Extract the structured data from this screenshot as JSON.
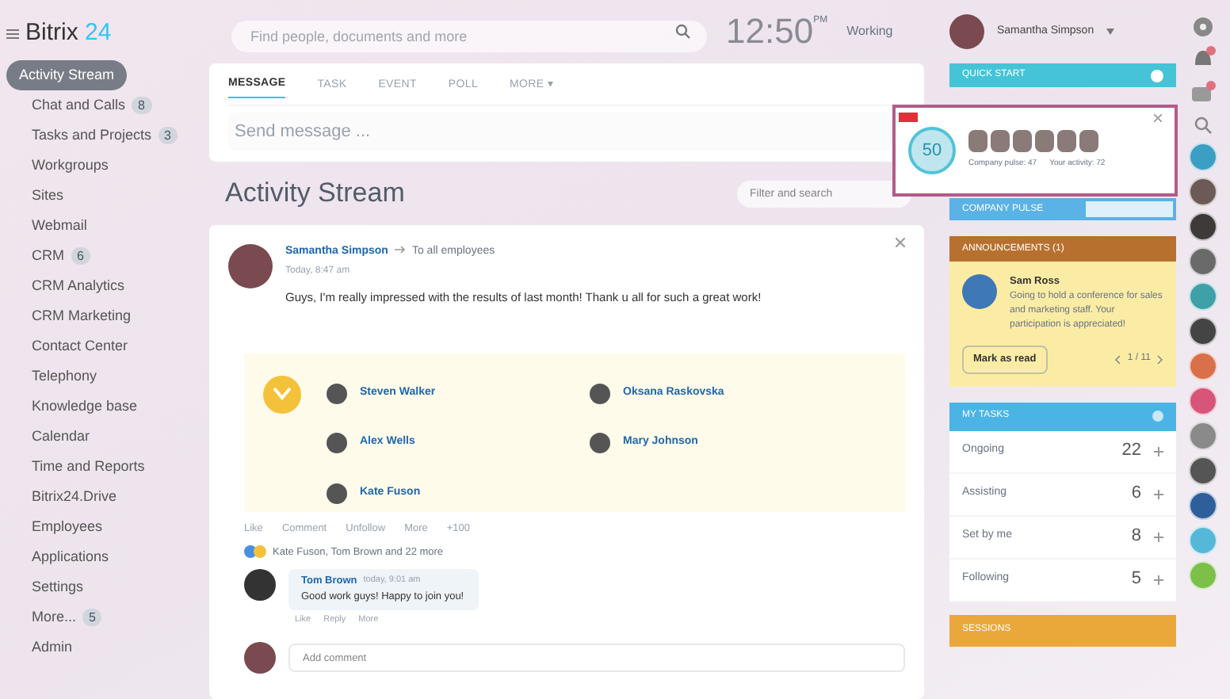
{
  "logo": {
    "name": "Bitrix",
    "suffix": "24"
  },
  "sidebar": {
    "items": [
      {
        "label": "Activity Stream",
        "selected": true
      },
      {
        "label": "Chat and Calls",
        "counter": "8",
        "selected": false
      },
      {
        "label": "Tasks and Projects",
        "counter": "3",
        "selected": false
      },
      {
        "label": "Workgroups",
        "selected": false
      },
      {
        "label": "Sites",
        "selected": false
      },
      {
        "label": "Webmail",
        "selected": false
      },
      {
        "label": "CRM",
        "counter": "6",
        "selected": false
      },
      {
        "label": "CRM Analytics",
        "selected": false
      },
      {
        "label": "CRM Marketing",
        "selected": false
      },
      {
        "label": "Contact Center",
        "selected": false
      },
      {
        "label": "Telephony",
        "selected": false
      },
      {
        "label": "Knowledge base",
        "selected": false
      },
      {
        "label": "Calendar",
        "selected": false
      },
      {
        "label": "Time and Reports",
        "selected": false
      },
      {
        "label": "Bitrix24.Drive",
        "selected": false
      },
      {
        "label": "Employees",
        "selected": false
      },
      {
        "label": "Applications",
        "selected": false
      },
      {
        "label": "Settings",
        "selected": false
      },
      {
        "label": "More...",
        "counter": "5",
        "selected": false
      },
      {
        "label": "Admin",
        "selected": false
      }
    ]
  },
  "header": {
    "search": {
      "placeholder": "Find people, documents and more"
    },
    "clock": "12:50",
    "clock_suffix": "PM",
    "status": "Working"
  },
  "composer": {
    "tabs": [
      {
        "label": "MESSAGE",
        "selected": true
      },
      {
        "label": "TASK",
        "selected": false
      },
      {
        "label": "EVENT",
        "selected": false
      },
      {
        "label": "POLL",
        "selected": false
      },
      {
        "label": "MORE ▾",
        "selected": false
      }
    ],
    "placeholder": "Send message ..."
  },
  "stream": {
    "title": "Activity Stream",
    "filter_placeholder": "Filter and search"
  },
  "post": {
    "author": "Samantha Simpson",
    "audience": "To all employees",
    "time": "Today, 8:47 am",
    "text": "Guys, I'm really impressed with the results of last month! Thank u all for such a great work!",
    "recipients": [
      {
        "name": "Steven Walker"
      },
      {
        "name": "Oksana Raskovska"
      },
      {
        "name": "Alex Wells"
      },
      {
        "name": "Mary Johnson"
      },
      {
        "name": "Kate Fuson"
      }
    ],
    "actions": [
      "Like",
      "Comment",
      "Unfollow",
      "More",
      "+100"
    ],
    "likes": "Kate Fuson, Tom Brown and 22 more",
    "comment": {
      "author": "Tom Brown",
      "time": "today, 9:01 am",
      "text": "Good work guys! Happy to join you!",
      "actions": [
        "Like",
        "Reply",
        "More"
      ]
    },
    "reply_placeholder": "Add comment"
  },
  "profile": {
    "name": "Samantha Simpson"
  },
  "widgets": {
    "quick_start": "QUICK START",
    "pulse": {
      "value": "50",
      "caption_left": "Company pulse: 47",
      "caption_right": "Your activity: 72"
    },
    "pulse_bar": "COMPANY PULSE",
    "announcement": {
      "title": "ANNOUNCEMENTS (1)",
      "author": "Sam Ross",
      "text": "Going to hold a conference for sales and marketing staff. Your participation is appreciated!",
      "button": "Mark as read",
      "pager": "1 / 11"
    },
    "tasks": {
      "title": "MY TASKS",
      "rows": [
        {
          "label": "Ongoing",
          "count": "22"
        },
        {
          "label": "Assisting",
          "count": "6"
        },
        {
          "label": "Set by me",
          "count": "8"
        },
        {
          "label": "Following",
          "count": "5"
        }
      ]
    },
    "bottom": "SESSIONS"
  }
}
